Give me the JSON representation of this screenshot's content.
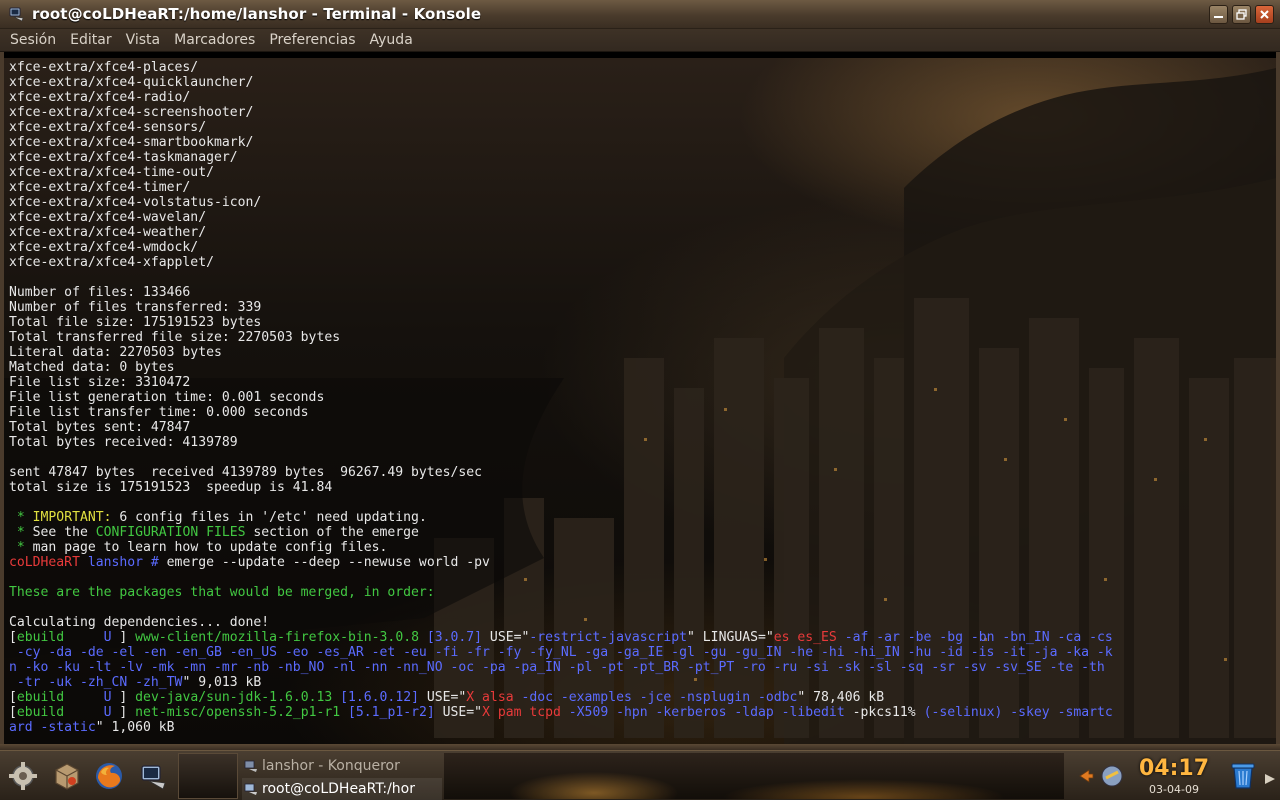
{
  "window": {
    "title": "root@coLDHeaRT:/home/lanshor - Terminal - Konsole"
  },
  "menubar": {
    "items": [
      "Sesión",
      "Editar",
      "Vista",
      "Marcadores",
      "Preferencias",
      "Ayuda"
    ]
  },
  "terminal": {
    "lines": [
      [
        {
          "t": "xfce-extra/xfce4-places/",
          "c": ""
        }
      ],
      [
        {
          "t": "xfce-extra/xfce4-quicklauncher/",
          "c": ""
        }
      ],
      [
        {
          "t": "xfce-extra/xfce4-radio/",
          "c": ""
        }
      ],
      [
        {
          "t": "xfce-extra/xfce4-screenshooter/",
          "c": ""
        }
      ],
      [
        {
          "t": "xfce-extra/xfce4-sensors/",
          "c": ""
        }
      ],
      [
        {
          "t": "xfce-extra/xfce4-smartbookmark/",
          "c": ""
        }
      ],
      [
        {
          "t": "xfce-extra/xfce4-taskmanager/",
          "c": ""
        }
      ],
      [
        {
          "t": "xfce-extra/xfce4-time-out/",
          "c": ""
        }
      ],
      [
        {
          "t": "xfce-extra/xfce4-timer/",
          "c": ""
        }
      ],
      [
        {
          "t": "xfce-extra/xfce4-volstatus-icon/",
          "c": ""
        }
      ],
      [
        {
          "t": "xfce-extra/xfce4-wavelan/",
          "c": ""
        }
      ],
      [
        {
          "t": "xfce-extra/xfce4-weather/",
          "c": ""
        }
      ],
      [
        {
          "t": "xfce-extra/xfce4-wmdock/",
          "c": ""
        }
      ],
      [
        {
          "t": "xfce-extra/xfce4-xfapplet/",
          "c": ""
        }
      ],
      [
        {
          "t": "",
          "c": ""
        }
      ],
      [
        {
          "t": "Number of files: 133466",
          "c": ""
        }
      ],
      [
        {
          "t": "Number of files transferred: 339",
          "c": ""
        }
      ],
      [
        {
          "t": "Total file size: 175191523 bytes",
          "c": ""
        }
      ],
      [
        {
          "t": "Total transferred file size: 2270503 bytes",
          "c": ""
        }
      ],
      [
        {
          "t": "Literal data: 2270503 bytes",
          "c": ""
        }
      ],
      [
        {
          "t": "Matched data: 0 bytes",
          "c": ""
        }
      ],
      [
        {
          "t": "File list size: 3310472",
          "c": ""
        }
      ],
      [
        {
          "t": "File list generation time: 0.001 seconds",
          "c": ""
        }
      ],
      [
        {
          "t": "File list transfer time: 0.000 seconds",
          "c": ""
        }
      ],
      [
        {
          "t": "Total bytes sent: 47847",
          "c": ""
        }
      ],
      [
        {
          "t": "Total bytes received: 4139789",
          "c": ""
        }
      ],
      [
        {
          "t": "",
          "c": ""
        }
      ],
      [
        {
          "t": "sent 47847 bytes  received 4139789 bytes  96267.49 bytes/sec",
          "c": ""
        }
      ],
      [
        {
          "t": "total size is 175191523  speedup is 41.84",
          "c": ""
        }
      ],
      [
        {
          "t": "",
          "c": ""
        }
      ],
      [
        {
          "t": " * ",
          "c": "c-green"
        },
        {
          "t": "IMPORTANT:",
          "c": "c-yellow"
        },
        {
          "t": " 6 config files in '/etc' need updating.",
          "c": ""
        }
      ],
      [
        {
          "t": " * ",
          "c": "c-green"
        },
        {
          "t": "See the ",
          "c": ""
        },
        {
          "t": "CONFIGURATION FILES",
          "c": "c-green"
        },
        {
          "t": " section of the emerge",
          "c": ""
        }
      ],
      [
        {
          "t": " * ",
          "c": "c-green"
        },
        {
          "t": "man page to learn how to update config files.",
          "c": ""
        }
      ],
      [
        {
          "t": "coLDHeaRT",
          "c": "c-red"
        },
        {
          "t": " lanshor # ",
          "c": "c-blue"
        },
        {
          "t": "emerge --update --deep --newuse world -pv",
          "c": ""
        }
      ],
      [
        {
          "t": "",
          "c": ""
        }
      ],
      [
        {
          "t": "These are the packages that would be merged, in order:",
          "c": "c-green"
        }
      ],
      [
        {
          "t": "",
          "c": ""
        }
      ],
      [
        {
          "t": "Calculating dependencies... done!",
          "c": ""
        }
      ],
      [
        {
          "t": "[",
          "c": ""
        },
        {
          "t": "ebuild",
          "c": "c-green"
        },
        {
          "t": "     U ",
          "c": "c-blue"
        },
        {
          "t": "] ",
          "c": ""
        },
        {
          "t": "www-client/mozilla-firefox-bin-3.0.8",
          "c": "c-green"
        },
        {
          "t": " [3.0.7]",
          "c": "c-blue"
        },
        {
          "t": " USE=\"",
          "c": ""
        },
        {
          "t": "-restrict-javascript",
          "c": "c-blue"
        },
        {
          "t": "\" LINGUAS=\"",
          "c": ""
        },
        {
          "t": "es es_ES",
          "c": "c-red"
        },
        {
          "t": " -af -ar -be -bg -bn -bn_IN -ca -cs",
          "c": "c-blue"
        }
      ],
      [
        {
          "t": " -cy -da -de -el -en -en_GB -en_US -eo -es_AR -et -eu -fi -fr -fy -fy_NL -ga -ga_IE -gl -gu -gu_IN -he -hi -hi_IN -hu -id -is -it -ja -ka -k",
          "c": "c-blue"
        }
      ],
      [
        {
          "t": "n -ko -ku -lt -lv -mk -mn -mr -nb -nb_NO -nl -nn -nn_NO -oc -pa -pa_IN -pl -pt -pt_BR -pt_PT -ro -ru -si -sk -sl -sq -sr -sv -sv_SE -te -th",
          "c": "c-blue"
        }
      ],
      [
        {
          "t": " -tr -uk -zh_CN -zh_TW",
          "c": "c-blue"
        },
        {
          "t": "\" 9,013 kB",
          "c": ""
        }
      ],
      [
        {
          "t": "[",
          "c": ""
        },
        {
          "t": "ebuild",
          "c": "c-green"
        },
        {
          "t": "     U ",
          "c": "c-blue"
        },
        {
          "t": "] ",
          "c": ""
        },
        {
          "t": "dev-java/sun-jdk-1.6.0.13",
          "c": "c-green"
        },
        {
          "t": " [1.6.0.12]",
          "c": "c-blue"
        },
        {
          "t": " USE=\"",
          "c": ""
        },
        {
          "t": "X alsa",
          "c": "c-red"
        },
        {
          "t": " -doc -examples -jce -nsplugin -odbc",
          "c": "c-blue"
        },
        {
          "t": "\" 78,406 kB",
          "c": ""
        }
      ],
      [
        {
          "t": "[",
          "c": ""
        },
        {
          "t": "ebuild",
          "c": "c-green"
        },
        {
          "t": "     U ",
          "c": "c-blue"
        },
        {
          "t": "] ",
          "c": ""
        },
        {
          "t": "net-misc/openssh-5.2_p1-r1",
          "c": "c-green"
        },
        {
          "t": " [5.1_p1-r2]",
          "c": "c-blue"
        },
        {
          "t": " USE=\"",
          "c": ""
        },
        {
          "t": "X pam tcpd",
          "c": "c-red"
        },
        {
          "t": " -X509 -hpn -kerberos -ldap -libedit ",
          "c": "c-blue"
        },
        {
          "t": "-pkcs11%",
          "c": ""
        },
        {
          "t": " ",
          "c": ""
        },
        {
          "t": "(-selinux) -skey -smartc",
          "c": "c-blue"
        }
      ],
      [
        {
          "t": "ard -static",
          "c": "c-blue"
        },
        {
          "t": "\" 1,060 kB",
          "c": ""
        }
      ]
    ]
  },
  "taskbar": {
    "tasks": [
      {
        "label": "lanshor - Konqueror",
        "active": false
      },
      {
        "label": "root@coLDHeaRT:/hor",
        "active": true
      }
    ],
    "clock": {
      "time": "04:17",
      "date": "03-04-09"
    },
    "launchers": [
      "settings-icon",
      "package-icon",
      "firefox-icon",
      "konsole-icon"
    ]
  },
  "colors": {
    "title_text": "#ffffff",
    "terminal_green": "#42c842",
    "terminal_yellow": "#e0e040",
    "terminal_red": "#e83a3a",
    "terminal_blue": "#5b6bff",
    "clock_orange": "#ffb640"
  }
}
